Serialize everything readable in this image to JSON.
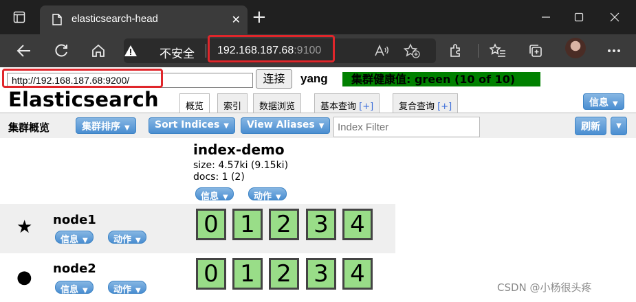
{
  "browser": {
    "tab_title": "elasticsearch-head",
    "tab_close": "✕",
    "new_tab": "+",
    "security_label": "不安全",
    "url_host": "192.168.187.68",
    "url_port": ":9100"
  },
  "page": {
    "connect_url": "http://192.168.187.68:9200/",
    "connect_button": "连接",
    "cluster_name": "yang",
    "cluster_health": "集群健康值: green (10 of 10)",
    "app_title": "Elasticsearch",
    "tabs": [
      {
        "label": "概览",
        "plus": ""
      },
      {
        "label": "索引",
        "plus": ""
      },
      {
        "label": "数据浏览",
        "plus": ""
      },
      {
        "label": "基本查询",
        "plus": "[+]"
      },
      {
        "label": "复合查询",
        "plus": "[+]"
      }
    ],
    "info_menu": "信息",
    "overview_label": "集群概览",
    "sort_cluster_button": "集群排序",
    "sort_indices_button": "Sort Indices",
    "view_aliases_button": "View Aliases",
    "index_filter_placeholder": "Index Filter",
    "refresh_button": "刷新",
    "index": {
      "name": "index-demo",
      "size": "size: 4.57ki (9.15ki)",
      "docs": "docs: 1 (2)",
      "info_button": "信息",
      "action_button": "动作"
    },
    "nodes": [
      {
        "name": "node1",
        "icon": "★",
        "info_button": "信息",
        "action_button": "动作",
        "shards": [
          "0",
          "1",
          "2",
          "3",
          "4"
        ]
      },
      {
        "name": "node2",
        "icon": "●",
        "info_button": "信息",
        "action_button": "动作",
        "shards": [
          "0",
          "1",
          "2",
          "3",
          "4"
        ]
      }
    ],
    "watermark": "CSDN @小杨很头疼"
  },
  "colors": {
    "health_green": "#008000",
    "shard_fill": "#99dd88",
    "button_blue": "#4a8ed1",
    "highlight_red": "#e0262b"
  }
}
